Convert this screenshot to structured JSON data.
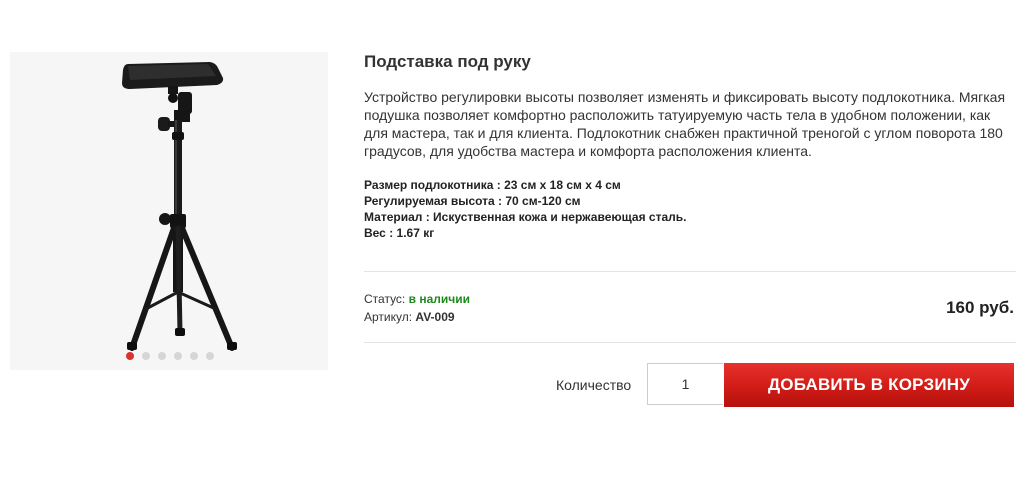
{
  "product": {
    "title": "Подставка под руку",
    "description": "Устройство регулировки высоты позволяет изменять и фиксировать высоту подлокотника. Мягкая подушка позволяет комфортно расположить татуируемую часть тела в удобном положении, как для мастера, так и для клиента. Подлокотник снабжен практичной треногой с углом поворота 180 градусов, для удобства мастера и комфорта расположения клиента.",
    "specs": [
      "Размер подлокотника : 23 см х 18 см х 4 см",
      "Регулируемая высота : 70 см-120 см",
      "Материал : Искуственная кожа и нержавеющая сталь.",
      "Вес : 1.67 кг"
    ],
    "status_label": "Статус:",
    "status_value": "в наличии",
    "sku_label": "Артикул:",
    "sku_value": "AV-009",
    "price": "160 руб."
  },
  "gallery": {
    "image_icon": "tripod-armrest-image",
    "slide_count": 6,
    "active_slide": 1,
    "active_color": "#d9322f"
  },
  "cart": {
    "quantity_label": "Количество",
    "quantity_value": "1",
    "add_button_label": "ДОБАВИТЬ В КОРЗИНУ",
    "button_color": "#d01c17"
  },
  "colors": {
    "in_stock": "#1e8a1e"
  }
}
